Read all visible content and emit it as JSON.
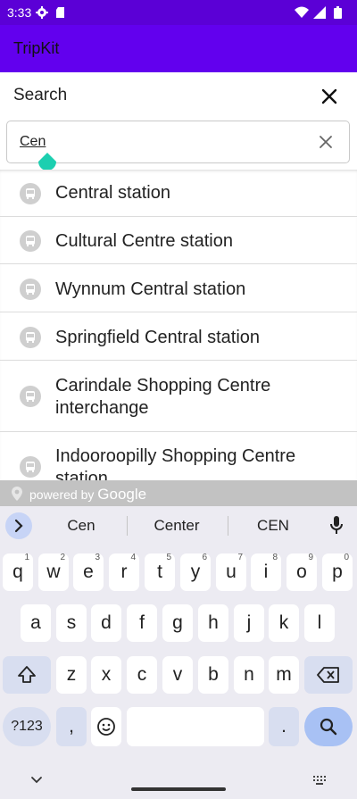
{
  "status_bar": {
    "time": "3:33"
  },
  "app_bar": {
    "title": "TripKit"
  },
  "search": {
    "title": "Search",
    "query": "Cen"
  },
  "results": [
    {
      "label": "Central station"
    },
    {
      "label": "Cultural Centre station"
    },
    {
      "label": "Wynnum Central station"
    },
    {
      "label": "Springfield Central station"
    },
    {
      "label": "Carindale Shopping Centre interchange"
    },
    {
      "label": "Indooroopilly Shopping Centre station"
    }
  ],
  "attribution": {
    "prefix": "powered by",
    "brand": "Google"
  },
  "keyboard": {
    "suggestions": [
      "Cen",
      "Center",
      "CEN"
    ],
    "row1": [
      {
        "k": "q",
        "h": "1"
      },
      {
        "k": "w",
        "h": "2"
      },
      {
        "k": "e",
        "h": "3"
      },
      {
        "k": "r",
        "h": "4"
      },
      {
        "k": "t",
        "h": "5"
      },
      {
        "k": "y",
        "h": "6"
      },
      {
        "k": "u",
        "h": "7"
      },
      {
        "k": "i",
        "h": "8"
      },
      {
        "k": "o",
        "h": "9"
      },
      {
        "k": "p",
        "h": "0"
      }
    ],
    "row2": [
      "a",
      "s",
      "d",
      "f",
      "g",
      "h",
      "j",
      "k",
      "l"
    ],
    "row3": [
      "z",
      "x",
      "c",
      "v",
      "b",
      "n",
      "m"
    ],
    "symbols_label": "?123",
    "comma": ",",
    "period": "."
  }
}
